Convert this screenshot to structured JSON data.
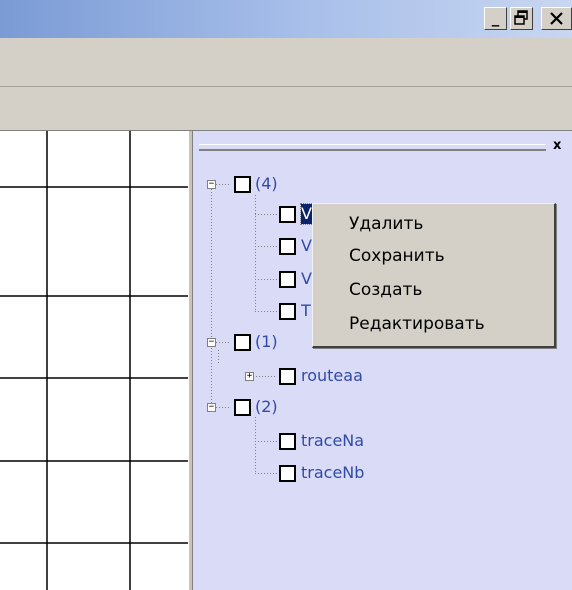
{
  "window": {
    "minimize_glyph": "_",
    "restore_glyph": "🗗",
    "close_glyph": "✕"
  },
  "panel": {
    "close_glyph": "x"
  },
  "tree": {
    "groups": [
      {
        "label": "(4)",
        "expanded": true,
        "children": [
          {
            "label": "V",
            "selected": true
          },
          {
            "label": "V"
          },
          {
            "label": "V"
          },
          {
            "label": "T"
          }
        ]
      },
      {
        "label": "(1)",
        "expanded": true,
        "children": [
          {
            "label": "routeaa",
            "collapsed_expander": true
          }
        ]
      },
      {
        "label": "(2)",
        "expanded": true,
        "children": [
          {
            "label": "traceNa"
          },
          {
            "label": "traceNb"
          }
        ]
      }
    ]
  },
  "context_menu": {
    "items": [
      {
        "label": "Удалить"
      },
      {
        "label": "Сохранить"
      },
      {
        "label": "Создать"
      },
      {
        "label": "Редактировать"
      }
    ]
  },
  "colors": {
    "panel_bg": "#dadcf7",
    "tree_text": "#2f4aa8",
    "title_gradient_start": "#7b9bd6"
  }
}
